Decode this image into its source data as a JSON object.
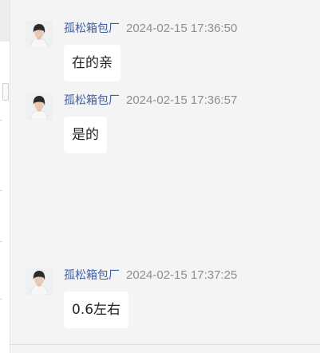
{
  "messages": [
    {
      "sender": "孤松箱包厂",
      "time": "2024-02-15 17:36:50",
      "text": "在的亲",
      "avatar_icon": "user-avatar-photo"
    },
    {
      "sender": "孤松箱包厂",
      "time": "2024-02-15 17:36:57",
      "text": "是的",
      "avatar_icon": "user-avatar-photo"
    },
    {
      "sender": "孤松箱包厂",
      "time": "2024-02-15 17:37:25",
      "text": "0.6左右",
      "avatar_icon": "user-avatar-photo"
    }
  ],
  "colors": {
    "background": "#f4f4f4",
    "bubble": "#ffffff",
    "sender": "#3b5ea8",
    "time": "#8f8f8f"
  }
}
